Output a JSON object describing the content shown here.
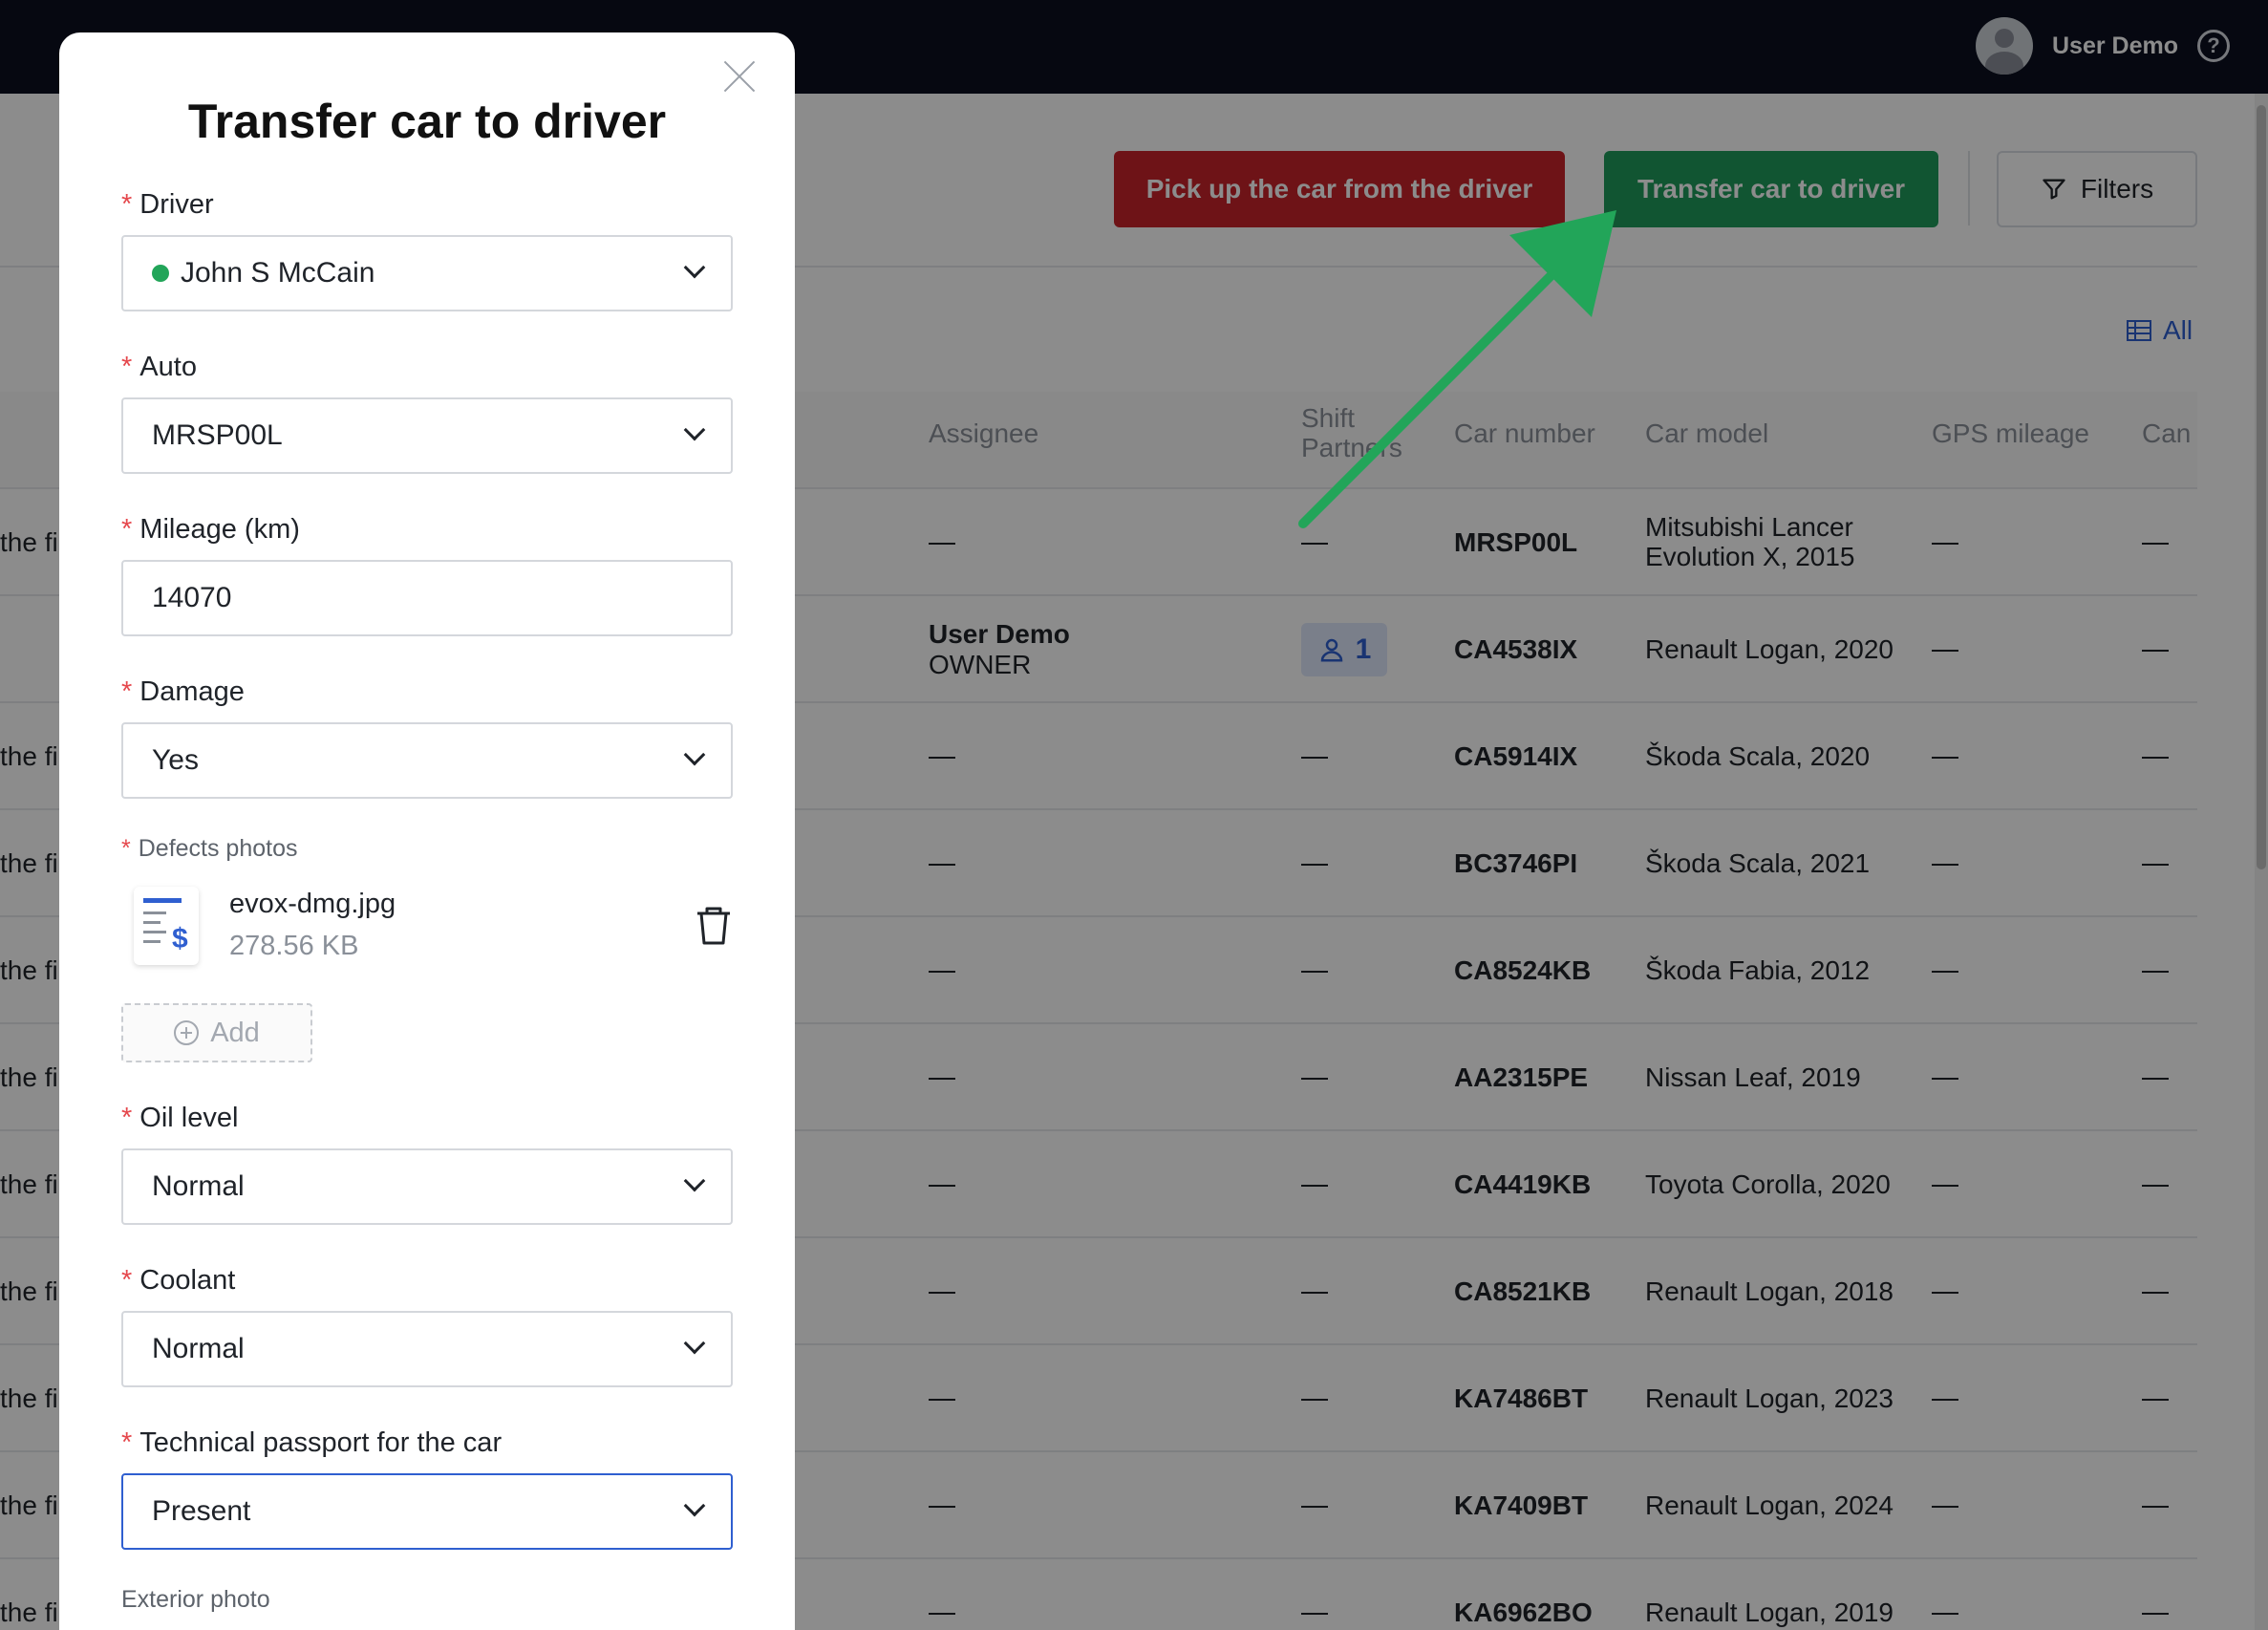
{
  "header": {
    "user_name": "User Demo",
    "help_icon": "?"
  },
  "toolbar": {
    "pickup_label": "Pick up the car from the driver",
    "transfer_label": "Transfer car to driver",
    "filters_label": "Filters",
    "all_label": "All"
  },
  "table": {
    "columns": [
      "Assignee",
      "Shift Partners",
      "Car number",
      "Car model",
      "GPS mileage",
      "Can"
    ],
    "left_fragment": "the fi",
    "rows": [
      {
        "assignee": "—",
        "assignee_role": "",
        "partners": "—",
        "car_number": "MRSP00L",
        "car_model": "Mitsubishi Lancer Evolution X, 2015",
        "gps": "—",
        "can": "—"
      },
      {
        "assignee": "User Demo",
        "assignee_role": "OWNER",
        "partners": "1",
        "car_number": "CA4538IX",
        "car_model": "Renault Logan, 2020",
        "gps": "—",
        "can": "—"
      },
      {
        "assignee": "—",
        "assignee_role": "",
        "partners": "—",
        "car_number": "CA5914IX",
        "car_model": "Škoda Scala, 2020",
        "gps": "—",
        "can": "—"
      },
      {
        "assignee": "—",
        "assignee_role": "",
        "partners": "—",
        "car_number": "BC3746PI",
        "car_model": "Škoda Scala, 2021",
        "gps": "—",
        "can": "—"
      },
      {
        "assignee": "—",
        "assignee_role": "",
        "partners": "—",
        "car_number": "CA8524KB",
        "car_model": "Škoda Fabia, 2012",
        "gps": "—",
        "can": "—"
      },
      {
        "assignee": "—",
        "assignee_role": "",
        "partners": "—",
        "car_number": "AA2315PE",
        "car_model": "Nissan Leaf, 2019",
        "gps": "—",
        "can": "—"
      },
      {
        "assignee": "—",
        "assignee_role": "",
        "partners": "—",
        "car_number": "CA4419KB",
        "car_model": "Toyota Corolla, 2020",
        "gps": "—",
        "can": "—"
      },
      {
        "assignee": "—",
        "assignee_role": "",
        "partners": "—",
        "car_number": "CA8521KB",
        "car_model": "Renault Logan, 2018",
        "gps": "—",
        "can": "—"
      },
      {
        "assignee": "—",
        "assignee_role": "",
        "partners": "—",
        "car_number": "KA7486BT",
        "car_model": "Renault Logan, 2023",
        "gps": "—",
        "can": "—"
      },
      {
        "assignee": "—",
        "assignee_role": "",
        "partners": "—",
        "car_number": "KA7409BT",
        "car_model": "Renault Logan, 2024",
        "gps": "—",
        "can": "—"
      },
      {
        "assignee": "—",
        "assignee_role": "",
        "partners": "—",
        "car_number": "KA6962BO",
        "car_model": "Renault Logan, 2019",
        "gps": "—",
        "can": "—"
      }
    ]
  },
  "modal": {
    "title": "Transfer car to driver",
    "driver": {
      "label": "Driver",
      "value": "John S McCain"
    },
    "auto": {
      "label": "Auto",
      "value": "MRSP00L"
    },
    "mileage": {
      "label": "Mileage (km)",
      "value": "14070"
    },
    "damage": {
      "label": "Damage",
      "value": "Yes"
    },
    "defects": {
      "label": "Defects photos",
      "file_name": "evox-dmg.jpg",
      "file_size": "278.56 KB",
      "add_label": "Add"
    },
    "oil": {
      "label": "Oil level",
      "value": "Normal"
    },
    "coolant": {
      "label": "Coolant",
      "value": "Normal"
    },
    "passport": {
      "label": "Technical passport for the car",
      "value": "Present"
    },
    "exterior": {
      "label": "Exterior photo"
    }
  },
  "colors": {
    "pickup_button": "#c8242b",
    "transfer_button": "#1f9c5c",
    "arrow": "#22a559",
    "accent_blue": "#2f5fd0",
    "required": "#e5484d"
  }
}
